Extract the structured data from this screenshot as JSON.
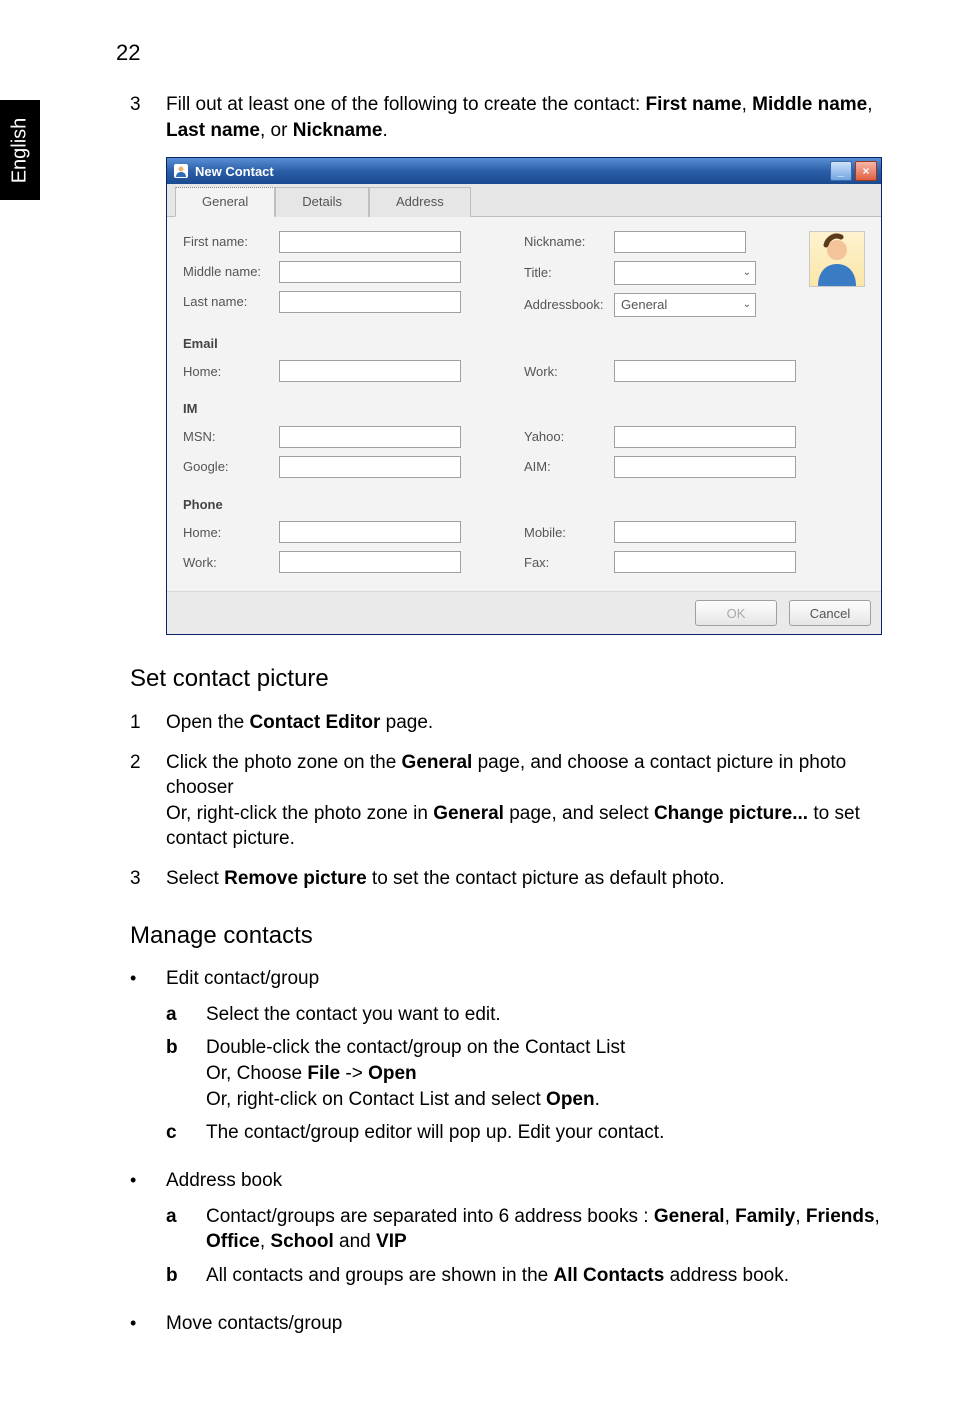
{
  "page_number": "22",
  "side_tab": "English",
  "step3": {
    "num": "3",
    "text_a": "Fill out at least one of the following to create the contact: ",
    "bold_a": "First name",
    "sep1": ", ",
    "bold_b": "Middle name",
    "sep2": ", ",
    "bold_c": "Last name",
    "sep3": ", or ",
    "bold_d": "Nickname",
    "end": "."
  },
  "dialog": {
    "title": "New Contact",
    "tabs": {
      "general": "General",
      "details": "Details",
      "address": "Address"
    },
    "labels": {
      "first_name": "First name:",
      "middle_name": "Middle name:",
      "last_name": "Last name:",
      "nickname": "Nickname:",
      "title": "Title:",
      "addressbook": "Addressbook:",
      "addressbook_value": "General",
      "email_hdr": "Email",
      "home": "Home:",
      "work": "Work:",
      "im_hdr": "IM",
      "msn": "MSN:",
      "google": "Google:",
      "yahoo": "Yahoo:",
      "aim": "AIM:",
      "phone_hdr": "Phone",
      "p_home": "Home:",
      "mobile": "Mobile:",
      "p_work": "Work:",
      "fax": "Fax:"
    },
    "buttons": {
      "ok": "OK",
      "cancel": "Cancel"
    }
  },
  "set_picture": {
    "heading": "Set contact picture",
    "s1_num": "1",
    "s1_a": "Open the ",
    "s1_b": "Contact Editor",
    "s1_c": " page.",
    "s2_num": "2",
    "s2_a": "Click the photo zone on the ",
    "s2_b": "General",
    "s2_c": " page, and choose a contact picture in photo chooser",
    "s2_d": "Or, right-click the photo zone in ",
    "s2_e": "General",
    "s2_f": " page, and select ",
    "s2_g": "Change picture...",
    "s2_h": " to set contact picture.",
    "s3_num": "3",
    "s3_a": "Select ",
    "s3_b": "Remove picture",
    "s3_c": " to set the contact picture as default photo."
  },
  "manage": {
    "heading": "Manage contacts",
    "edit_label": "Edit contact/group",
    "edit_a_lbl": "a",
    "edit_a_txt": "Select the contact you want to edit.",
    "edit_b_lbl": "b",
    "edit_b_1": "Double-click the contact/group on the Contact List",
    "edit_b_2a": "Or, Choose ",
    "edit_b_2b": "File",
    "edit_b_2c": " -> ",
    "edit_b_2d": "Open",
    "edit_b_3a": "Or, right-click on Contact List and select ",
    "edit_b_3b": "Open",
    "edit_b_3c": ".",
    "edit_c_lbl": "c",
    "edit_c_txt": "The contact/group editor will pop up. Edit your contact.",
    "addr_label": "Address book",
    "addr_a_lbl": "a",
    "addr_a_1": "Contact/groups are separated into 6 address books : ",
    "addr_a_g": "General",
    "addr_a_s1": ", ",
    "addr_a_f": "Family",
    "addr_a_s2": ", ",
    "addr_a_fr": "Friends",
    "addr_a_s3": ", ",
    "addr_a_o": "Office",
    "addr_a_s4": ", ",
    "addr_a_sc": "School",
    "addr_a_and": " and ",
    "addr_a_v": "VIP",
    "addr_b_lbl": "b",
    "addr_b_1": "All contacts and groups are shown in the ",
    "addr_b_2": "All Contacts",
    "addr_b_3": " address book.",
    "move_label": "Move contacts/group"
  }
}
